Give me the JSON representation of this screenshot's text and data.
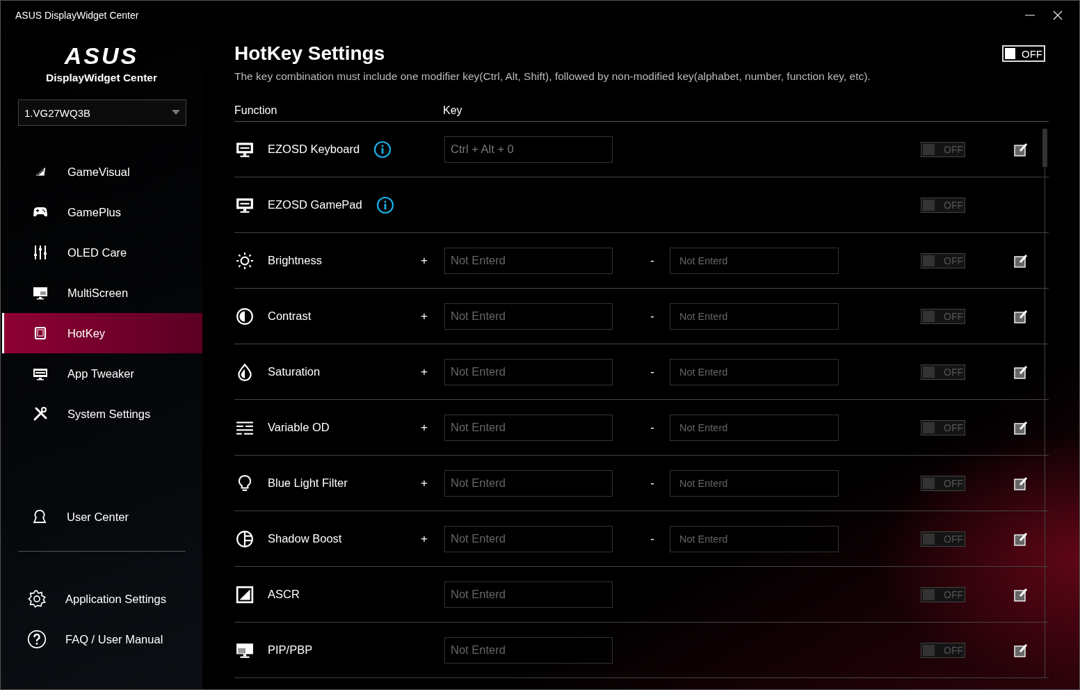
{
  "window": {
    "title": "ASUS DisplayWidget Center"
  },
  "brand": {
    "logo": "ASUS",
    "name": "DisplayWidget Center"
  },
  "monitor_select": {
    "value": "1.VG27WQ3B"
  },
  "nav": [
    {
      "label": "GameVisual",
      "selected": false
    },
    {
      "label": "GamePlus",
      "selected": false
    },
    {
      "label": "OLED Care",
      "selected": false
    },
    {
      "label": "MultiScreen",
      "selected": false
    },
    {
      "label": "HotKey",
      "selected": true
    },
    {
      "label": "App Tweaker",
      "selected": false
    },
    {
      "label": "System Settings",
      "selected": false
    }
  ],
  "user_center": {
    "label": "User Center"
  },
  "footer_nav": [
    {
      "label": "Application Settings"
    },
    {
      "label": "FAQ / User Manual"
    }
  ],
  "page": {
    "title": "HotKey Settings",
    "description": "The key combination must include one modifier key(Ctrl, Alt, Shift), followed by non-modified key(alphabet, number, function key, etc).",
    "master_toggle": {
      "label": "OFF",
      "on": false
    }
  },
  "columns": [
    "Function",
    "Key"
  ],
  "rows": [
    {
      "kind": "single",
      "label": "EZOSD Keyboard",
      "info": true,
      "fields": [
        {
          "value": "Ctrl + Alt + 0"
        }
      ],
      "toggle": {
        "label": "OFF",
        "on": false,
        "disabled": true
      },
      "editable": true
    },
    {
      "kind": "none",
      "label": "EZOSD GamePad",
      "info": true,
      "fields": [],
      "toggle": {
        "label": "OFF",
        "on": false,
        "disabled": true
      },
      "editable": false
    },
    {
      "kind": "pair",
      "label": "Brightness",
      "info": false,
      "fields": [
        {
          "sign": "+",
          "placeholder": "Not Enterd"
        },
        {
          "sign": "-",
          "placeholder": "Not Enterd"
        }
      ],
      "toggle": {
        "label": "OFF",
        "on": false,
        "disabled": true
      },
      "editable": true
    },
    {
      "kind": "pair",
      "label": "Contrast",
      "info": false,
      "fields": [
        {
          "sign": "+",
          "placeholder": "Not Enterd"
        },
        {
          "sign": "-",
          "placeholder": "Not Enterd"
        }
      ],
      "toggle": {
        "label": "OFF",
        "on": false,
        "disabled": true
      },
      "editable": true
    },
    {
      "kind": "pair",
      "label": "Saturation",
      "info": false,
      "fields": [
        {
          "sign": "+",
          "placeholder": "Not Enterd"
        },
        {
          "sign": "-",
          "placeholder": "Not Enterd"
        }
      ],
      "toggle": {
        "label": "OFF",
        "on": false,
        "disabled": true
      },
      "editable": true
    },
    {
      "kind": "pair",
      "label": "Variable OD",
      "info": false,
      "fields": [
        {
          "sign": "+",
          "placeholder": "Not Enterd"
        },
        {
          "sign": "-",
          "placeholder": "Not Enterd"
        }
      ],
      "toggle": {
        "label": "OFF",
        "on": false,
        "disabled": true
      },
      "editable": true
    },
    {
      "kind": "pair",
      "label": "Blue Light Filter",
      "info": false,
      "fields": [
        {
          "sign": "+",
          "placeholder": "Not Enterd"
        },
        {
          "sign": "-",
          "placeholder": "Not Enterd"
        }
      ],
      "toggle": {
        "label": "OFF",
        "on": false,
        "disabled": true
      },
      "editable": true
    },
    {
      "kind": "pair",
      "label": "Shadow Boost",
      "info": false,
      "fields": [
        {
          "sign": "+",
          "placeholder": "Not Enterd"
        },
        {
          "sign": "-",
          "placeholder": "Not Enterd"
        }
      ],
      "toggle": {
        "label": "OFF",
        "on": false,
        "disabled": true
      },
      "editable": true
    },
    {
      "kind": "single",
      "label": "ASCR",
      "info": false,
      "fields": [
        {
          "placeholder": "Not Enterd"
        }
      ],
      "toggle": {
        "label": "OFF",
        "on": false,
        "disabled": true
      },
      "editable": true
    },
    {
      "kind": "single",
      "label": "PIP/PBP",
      "info": false,
      "fields": [
        {
          "placeholder": "Not Enterd"
        }
      ],
      "toggle": {
        "label": "OFF",
        "on": false,
        "disabled": true
      },
      "editable": true
    }
  ]
}
